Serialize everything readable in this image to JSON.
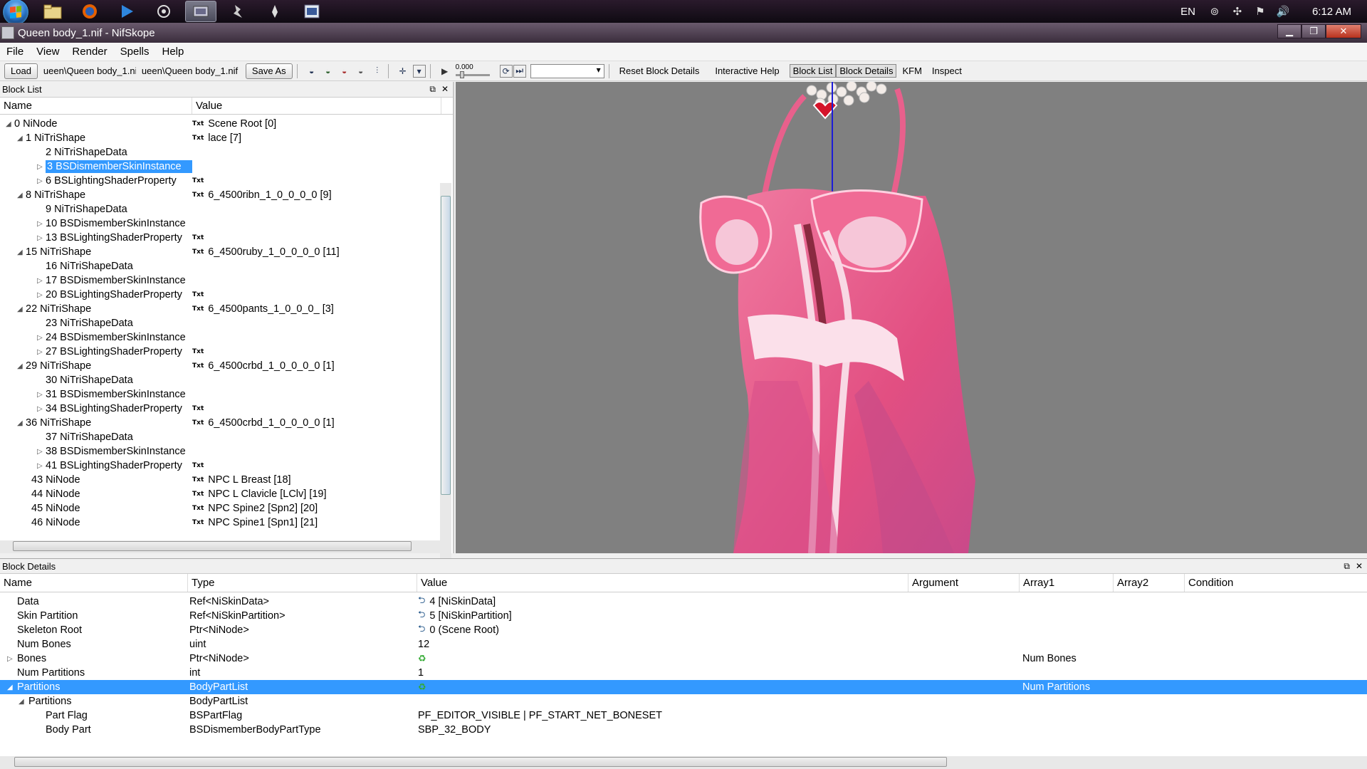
{
  "taskbar": {
    "language": "EN",
    "clock": "6:12 AM"
  },
  "window": {
    "title": "Queen body_1.nif - NifSkope",
    "minimize": "▁",
    "maximize": "❐",
    "close": "✕"
  },
  "menu": [
    "File",
    "View",
    "Render",
    "Spells",
    "Help"
  ],
  "toolbar": {
    "load": "Load",
    "load_path": "ueen\\Queen body_1.nif",
    "save_path": "ueen\\Queen body_1.nif",
    "save_as": "Save As",
    "time_value": "0.000",
    "reset_block_details": "Reset Block Details",
    "interactive_help": "Interactive Help",
    "block_list": "Block List",
    "block_details": "Block Details",
    "kfm": "KFM",
    "inspect": "Inspect"
  },
  "block_list": {
    "title": "Block List",
    "col_name": "Name",
    "col_value": "Value",
    "rows": [
      {
        "name": "0 NiNode",
        "value": "Scene Root [0]",
        "txt": "Txt"
      },
      {
        "name": "1 NiTriShape",
        "value": "lace [7]",
        "txt": "Txt"
      },
      {
        "name": "2 NiTriShapeData",
        "value": "",
        "txt": ""
      },
      {
        "name": "3 BSDismemberSkinInstance",
        "value": "",
        "txt": ""
      },
      {
        "name": "6 BSLightingShaderProperty",
        "value": "",
        "txt": "Txt"
      },
      {
        "name": "8 NiTriShape",
        "value": "6_4500ribn_1_0_0_0_0 [9]",
        "txt": "Txt"
      },
      {
        "name": "9 NiTriShapeData",
        "value": "",
        "txt": ""
      },
      {
        "name": "10 BSDismemberSkinInstance",
        "value": "",
        "txt": ""
      },
      {
        "name": "13 BSLightingShaderProperty",
        "value": "",
        "txt": "Txt"
      },
      {
        "name": "15 NiTriShape",
        "value": "6_4500ruby_1_0_0_0_0 [11]",
        "txt": "Txt"
      },
      {
        "name": "16 NiTriShapeData",
        "value": "",
        "txt": ""
      },
      {
        "name": "17 BSDismemberSkinInstance",
        "value": "",
        "txt": ""
      },
      {
        "name": "20 BSLightingShaderProperty",
        "value": "",
        "txt": "Txt"
      },
      {
        "name": "22 NiTriShape",
        "value": "6_4500pants_1_0_0_0_ [3]",
        "txt": "Txt"
      },
      {
        "name": "23 NiTriShapeData",
        "value": "",
        "txt": ""
      },
      {
        "name": "24 BSDismemberSkinInstance",
        "value": "",
        "txt": ""
      },
      {
        "name": "27 BSLightingShaderProperty",
        "value": "",
        "txt": "Txt"
      },
      {
        "name": "29 NiTriShape",
        "value": "6_4500crbd_1_0_0_0_0 [1]",
        "txt": "Txt"
      },
      {
        "name": "30 NiTriShapeData",
        "value": "",
        "txt": ""
      },
      {
        "name": "31 BSDismemberSkinInstance",
        "value": "",
        "txt": ""
      },
      {
        "name": "34 BSLightingShaderProperty",
        "value": "",
        "txt": "Txt"
      },
      {
        "name": "36 NiTriShape",
        "value": "6_4500crbd_1_0_0_0_0 [1]",
        "txt": "Txt"
      },
      {
        "name": "37 NiTriShapeData",
        "value": "",
        "txt": ""
      },
      {
        "name": "38 BSDismemberSkinInstance",
        "value": "",
        "txt": ""
      },
      {
        "name": "41 BSLightingShaderProperty",
        "value": "",
        "txt": "Txt"
      },
      {
        "name": "43 NiNode",
        "value": "NPC L Breast [18]",
        "txt": "Txt"
      },
      {
        "name": "44 NiNode",
        "value": "NPC L Clavicle [LClv] [19]",
        "txt": "Txt"
      },
      {
        "name": "45 NiNode",
        "value": "NPC Spine2 [Spn2] [20]",
        "txt": "Txt"
      },
      {
        "name": "46 NiNode",
        "value": "NPC Spine1 [Spn1] [21]",
        "txt": "Txt"
      }
    ]
  },
  "block_details": {
    "title": "Block Details",
    "columns": [
      "Name",
      "Type",
      "Value",
      "Argument",
      "Array1",
      "Array2",
      "Condition"
    ],
    "rows": [
      {
        "name": "Data",
        "type": "Ref<NiSkinData>",
        "value": "4 [NiSkinData]",
        "array1": ""
      },
      {
        "name": "Skin Partition",
        "type": "Ref<NiSkinPartition>",
        "value": "5 [NiSkinPartition]",
        "array1": ""
      },
      {
        "name": "Skeleton Root",
        "type": "Ptr<NiNode>",
        "value": "0 (Scene Root)",
        "array1": ""
      },
      {
        "name": "Num Bones",
        "type": "uint",
        "value": "12",
        "array1": ""
      },
      {
        "name": "Bones",
        "type": "Ptr<NiNode>",
        "value": "",
        "array1": "Num Bones"
      },
      {
        "name": "Num Partitions",
        "type": "int",
        "value": "1",
        "array1": ""
      },
      {
        "name": "Partitions",
        "type": "BodyPartList",
        "value": "",
        "array1": "Num Partitions"
      },
      {
        "name": "Partitions",
        "type": "BodyPartList",
        "value": "",
        "array1": ""
      },
      {
        "name": "Part Flag",
        "type": "BSPartFlag",
        "value": "PF_EDITOR_VISIBLE | PF_START_NET_BONESET",
        "array1": ""
      },
      {
        "name": "Body Part",
        "type": "BSDismemberBodyPartType",
        "value": "SBP_32_BODY",
        "array1": ""
      }
    ]
  },
  "colors": {
    "selection": "#3399ff",
    "viewport_bg": "#808080",
    "model_pink": "#e85a8a"
  }
}
